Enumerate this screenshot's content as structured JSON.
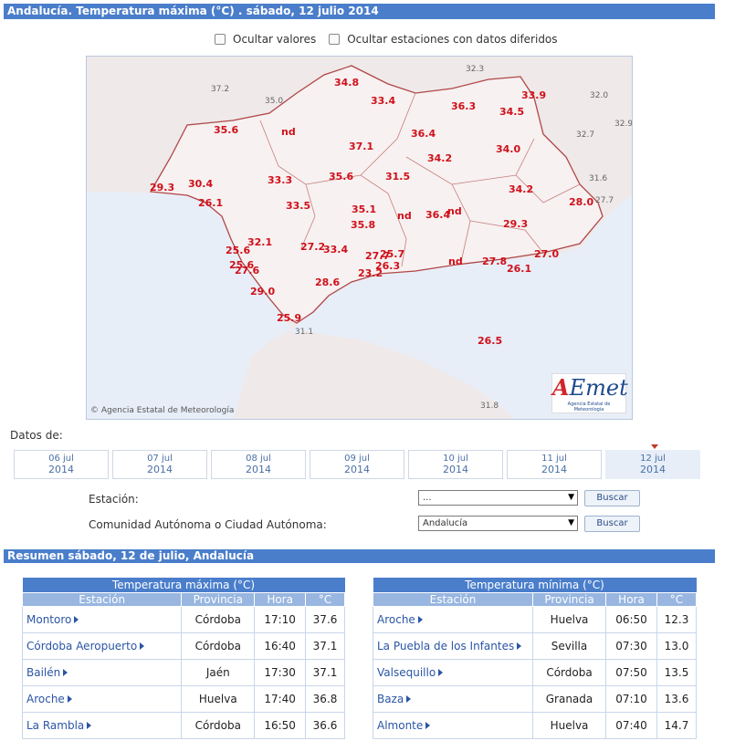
{
  "title": "Andalucía. Temperatura máxima (°C) . sábado, 12 julio 2014",
  "options": {
    "hide_values": "Ocultar valores",
    "hide_deferred": "Ocultar estaciones con datos diferidos"
  },
  "map": {
    "copyright": "Agencia Estatal de Meteorología",
    "logo_text": "AEmet",
    "logo_sub": "Agencia Estatal de Meteorología",
    "labels": [
      {
        "t": "32.3",
        "c": "gray"
      },
      {
        "t": "37.2",
        "c": "gray"
      },
      {
        "t": "35.0",
        "c": "gray"
      },
      {
        "t": "34.8",
        "c": "red"
      },
      {
        "t": "33.9",
        "c": "red"
      },
      {
        "t": "32.0",
        "c": "gray"
      },
      {
        "t": "33.4",
        "c": "red"
      },
      {
        "t": "36.3",
        "c": "red"
      },
      {
        "t": "34.5",
        "c": "red"
      },
      {
        "t": "32.9",
        "c": "gray"
      },
      {
        "t": "35.6",
        "c": "red"
      },
      {
        "t": "nd",
        "c": "red"
      },
      {
        "t": "36.4",
        "c": "red"
      },
      {
        "t": "32.7",
        "c": "gray"
      },
      {
        "t": "37.1",
        "c": "red"
      },
      {
        "t": "34.0",
        "c": "red"
      },
      {
        "t": "34.2",
        "c": "red"
      },
      {
        "t": "31.6",
        "c": "gray"
      },
      {
        "t": "33.3",
        "c": "red"
      },
      {
        "t": "35.6",
        "c": "red"
      },
      {
        "t": "31.5",
        "c": "red"
      },
      {
        "t": "29.3",
        "c": "red"
      },
      {
        "t": "30.4",
        "c": "red"
      },
      {
        "t": "34.2",
        "c": "red"
      },
      {
        "t": "26.1",
        "c": "red"
      },
      {
        "t": "28.0",
        "c": "red"
      },
      {
        "t": "27.7",
        "c": "gray"
      },
      {
        "t": "33.5",
        "c": "red"
      },
      {
        "t": "35.1",
        "c": "red"
      },
      {
        "t": "nd",
        "c": "red"
      },
      {
        "t": "36.4",
        "c": "red"
      },
      {
        "t": "nd",
        "c": "red"
      },
      {
        "t": "35.8",
        "c": "red"
      },
      {
        "t": "29.3",
        "c": "red"
      },
      {
        "t": "32.1",
        "c": "red"
      },
      {
        "t": "27.2",
        "c": "red"
      },
      {
        "t": "33.4",
        "c": "red"
      },
      {
        "t": "25.6",
        "c": "red"
      },
      {
        "t": "27.7",
        "c": "red"
      },
      {
        "t": "25.7",
        "c": "red"
      },
      {
        "t": "27.0",
        "c": "red"
      },
      {
        "t": "25.6",
        "c": "red"
      },
      {
        "t": "26.3",
        "c": "red"
      },
      {
        "t": "nd",
        "c": "red"
      },
      {
        "t": "27.8",
        "c": "red"
      },
      {
        "t": "27.6",
        "c": "red"
      },
      {
        "t": "23.2",
        "c": "red"
      },
      {
        "t": "26.1",
        "c": "red"
      },
      {
        "t": "28.6",
        "c": "red"
      },
      {
        "t": "29.0",
        "c": "red"
      },
      {
        "t": "25.9",
        "c": "red"
      },
      {
        "t": "31.1",
        "c": "gray"
      },
      {
        "t": "26.5",
        "c": "red"
      },
      {
        "t": "31.8",
        "c": "gray"
      }
    ]
  },
  "datos_label": "Datos de:",
  "dates": [
    {
      "d": "06 jul",
      "y": "2014"
    },
    {
      "d": "07 jul",
      "y": "2014"
    },
    {
      "d": "08 jul",
      "y": "2014"
    },
    {
      "d": "09 jul",
      "y": "2014"
    },
    {
      "d": "10 jul",
      "y": "2014"
    },
    {
      "d": "11 jul",
      "y": "2014"
    },
    {
      "d": "12 jul",
      "y": "2014"
    }
  ],
  "form": {
    "station_label": "Estación:",
    "station_value": "...",
    "community_label": "Comunidad Autónoma o Ciudad Autónoma:",
    "community_value": "Andalucía",
    "search": "Buscar"
  },
  "summary_title": "Resumen sábado, 12 de julio, Andalucía",
  "max_table": {
    "caption": "Temperatura máxima (°C)",
    "headers": [
      "Estación",
      "Provincia",
      "Hora",
      "°C"
    ],
    "rows": [
      [
        "Montoro",
        "Córdoba",
        "17:10",
        "37.6"
      ],
      [
        "Córdoba Aeropuerto",
        "Córdoba",
        "16:40",
        "37.1"
      ],
      [
        "Bailén",
        "Jaén",
        "17:30",
        "37.1"
      ],
      [
        "Aroche",
        "Huelva",
        "17:40",
        "36.8"
      ],
      [
        "La Rambla",
        "Córdoba",
        "16:50",
        "36.6"
      ]
    ]
  },
  "min_table": {
    "caption": "Temperatura mínima (°C)",
    "headers": [
      "Estación",
      "Provincia",
      "Hora",
      "°C"
    ],
    "rows": [
      [
        "Aroche",
        "Huelva",
        "06:50",
        "12.3"
      ],
      [
        "La Puebla de los Infantes",
        "Sevilla",
        "07:30",
        "13.0"
      ],
      [
        "Valsequillo",
        "Córdoba",
        "07:50",
        "13.5"
      ],
      [
        "Baza",
        "Granada",
        "07:10",
        "13.6"
      ],
      [
        "Almonte",
        "Huelva",
        "07:40",
        "14.7"
      ]
    ]
  }
}
